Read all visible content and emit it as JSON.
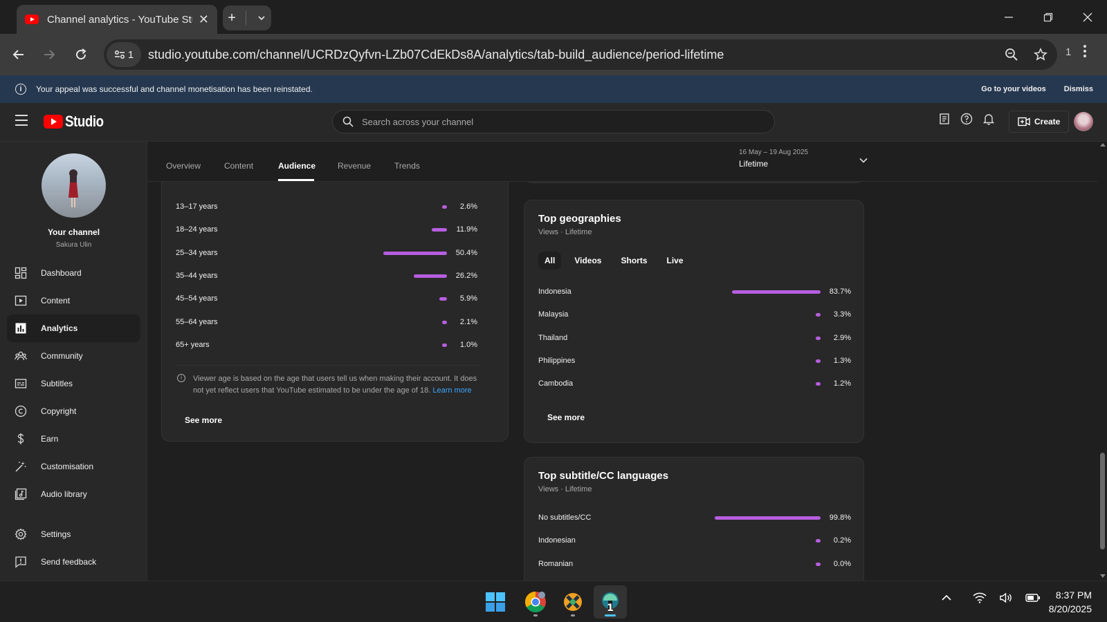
{
  "browser": {
    "tab_title": "Channel analytics - YouTube Studio",
    "site_info_count": "1",
    "url": "studio.youtube.com/channel/UCRDzQyfvn-LZb07CdEkDs8A/analytics/tab-build_audience/period-lifetime",
    "extensions_count": "1"
  },
  "notice": {
    "text": "Your appeal was successful and channel monetisation has been reinstated.",
    "go_to_videos": "Go to your videos",
    "dismiss": "Dismiss"
  },
  "header": {
    "logo_text": "Studio",
    "search_placeholder": "Search across your channel",
    "create_label": "Create"
  },
  "sidebar": {
    "channel_name": "Your channel",
    "channel_handle": "Sakura Ulin",
    "items": [
      {
        "label": "Dashboard",
        "icon": "dashboard-icon"
      },
      {
        "label": "Content",
        "icon": "content-icon"
      },
      {
        "label": "Analytics",
        "icon": "analytics-icon",
        "active": true
      },
      {
        "label": "Community",
        "icon": "community-icon"
      },
      {
        "label": "Subtitles",
        "icon": "subtitles-icon"
      },
      {
        "label": "Copyright",
        "icon": "copyright-icon"
      },
      {
        "label": "Earn",
        "icon": "earn-icon"
      },
      {
        "label": "Customisation",
        "icon": "customisation-icon"
      },
      {
        "label": "Audio library",
        "icon": "audio-library-icon"
      }
    ],
    "bottom_items": [
      {
        "label": "Settings",
        "icon": "settings-icon"
      },
      {
        "label": "Send feedback",
        "icon": "feedback-icon"
      }
    ]
  },
  "analytics_tabs": [
    {
      "label": "Overview"
    },
    {
      "label": "Content"
    },
    {
      "label": "Audience",
      "active": true
    },
    {
      "label": "Revenue"
    },
    {
      "label": "Trends"
    }
  ],
  "period": {
    "range": "16 May – 19 Aug 2025",
    "label": "Lifetime"
  },
  "age_card": {
    "rows": [
      {
        "label": "13–17 years",
        "pct": "2.6%",
        "value": 2.6
      },
      {
        "label": "18–24 years",
        "pct": "11.9%",
        "value": 11.9
      },
      {
        "label": "25–34 years",
        "pct": "50.4%",
        "value": 50.4
      },
      {
        "label": "35–44 years",
        "pct": "26.2%",
        "value": 26.2
      },
      {
        "label": "45–54 years",
        "pct": "5.9%",
        "value": 5.9
      },
      {
        "label": "55–64 years",
        "pct": "2.1%",
        "value": 2.1
      },
      {
        "label": "65+ years",
        "pct": "1.0%",
        "value": 1.0
      }
    ],
    "note": "Viewer age is based on the age that users tell us when making their account. It does not yet reflect users that YouTube estimated to be under the age of 18.",
    "learn_more": "Learn more",
    "see_more": "See more"
  },
  "geo_card": {
    "title": "Top geographies",
    "subtitle": "Views · Lifetime",
    "chips": [
      "All",
      "Videos",
      "Shorts",
      "Live"
    ],
    "rows": [
      {
        "label": "Indonesia",
        "pct": "83.7%",
        "value": 83.7
      },
      {
        "label": "Malaysia",
        "pct": "3.3%",
        "value": 3.3
      },
      {
        "label": "Thailand",
        "pct": "2.9%",
        "value": 2.9
      },
      {
        "label": "Philippines",
        "pct": "1.3%",
        "value": 1.3
      },
      {
        "label": "Cambodia",
        "pct": "1.2%",
        "value": 1.2
      }
    ],
    "see_more": "See more"
  },
  "subtitle_card": {
    "title": "Top subtitle/CC languages",
    "subtitle": "Views · Lifetime",
    "rows": [
      {
        "label": "No subtitles/CC",
        "pct": "99.8%",
        "value": 99.8
      },
      {
        "label": "Indonesian",
        "pct": "0.2%",
        "value": 0.2
      },
      {
        "label": "Romanian",
        "pct": "0.0%",
        "value": 0.0
      }
    ]
  },
  "taskbar": {
    "time": "8:37 PM",
    "date": "8/20/2025",
    "app_badge": "1"
  },
  "colors": {
    "bar": "#b75ee0",
    "accent_link": "#3ea6ff",
    "youtube_red": "#ff0000",
    "notice_bg": "#263850"
  }
}
